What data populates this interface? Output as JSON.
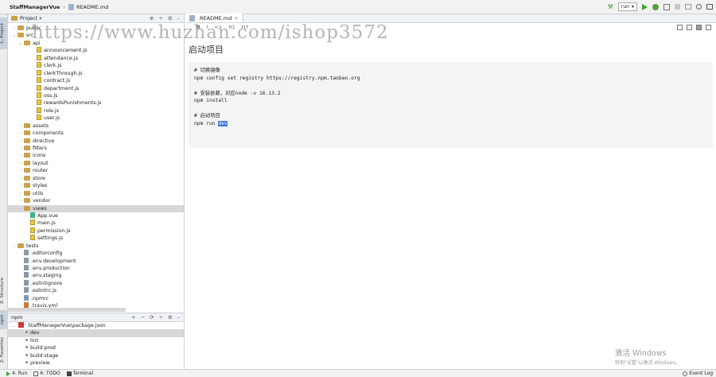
{
  "navbar": {
    "project": "StaffManagerVue",
    "file": "README.md",
    "run_config": "run"
  },
  "stripe": {
    "project_tab": "1: Project",
    "structure_tab": "Z: Structure",
    "npm_tab": "npm",
    "favorites_tab": "2: Favorites"
  },
  "project_panel": {
    "title": "Project",
    "tree": [
      {
        "label": "public",
        "indent": 1,
        "type": "folder",
        "arrow": "›"
      },
      {
        "label": "src",
        "indent": 1,
        "type": "folder",
        "arrow": "⌄"
      },
      {
        "label": "api",
        "indent": 2,
        "type": "folder",
        "arrow": "⌄"
      },
      {
        "label": "announcement.js",
        "indent": 4,
        "type": "js"
      },
      {
        "label": "attendance.js",
        "indent": 4,
        "type": "js"
      },
      {
        "label": "clerk.js",
        "indent": 4,
        "type": "js"
      },
      {
        "label": "clerkThrough.js",
        "indent": 4,
        "type": "js"
      },
      {
        "label": "contract.js",
        "indent": 4,
        "type": "js"
      },
      {
        "label": "department.js",
        "indent": 4,
        "type": "js"
      },
      {
        "label": "oss.js",
        "indent": 4,
        "type": "js"
      },
      {
        "label": "rewardsPunishments.js",
        "indent": 4,
        "type": "js"
      },
      {
        "label": "role.js",
        "indent": 4,
        "type": "js"
      },
      {
        "label": "user.js",
        "indent": 4,
        "type": "js"
      },
      {
        "label": "assets",
        "indent": 2,
        "type": "folder",
        "arrow": "›"
      },
      {
        "label": "components",
        "indent": 2,
        "type": "folder",
        "arrow": "›"
      },
      {
        "label": "directive",
        "indent": 2,
        "type": "folder",
        "arrow": "›"
      },
      {
        "label": "filters",
        "indent": 2,
        "type": "folder",
        "arrow": "›"
      },
      {
        "label": "icons",
        "indent": 2,
        "type": "folder",
        "arrow": "›"
      },
      {
        "label": "layout",
        "indent": 2,
        "type": "folder",
        "arrow": "›"
      },
      {
        "label": "router",
        "indent": 2,
        "type": "folder",
        "arrow": "›"
      },
      {
        "label": "store",
        "indent": 2,
        "type": "folder",
        "arrow": "›"
      },
      {
        "label": "styles",
        "indent": 2,
        "type": "folder",
        "arrow": "›"
      },
      {
        "label": "utils",
        "indent": 2,
        "type": "folder",
        "arrow": "›"
      },
      {
        "label": "vendor",
        "indent": 2,
        "type": "folder",
        "arrow": "›"
      },
      {
        "label": "views",
        "indent": 2,
        "type": "folder",
        "arrow": "›",
        "selected": true
      },
      {
        "label": "App.vue",
        "indent": 3,
        "type": "vue"
      },
      {
        "label": "main.js",
        "indent": 3,
        "type": "js"
      },
      {
        "label": "permission.js",
        "indent": 3,
        "type": "js"
      },
      {
        "label": "settings.js",
        "indent": 3,
        "type": "js"
      },
      {
        "label": "tests",
        "indent": 1,
        "type": "folder",
        "arrow": "›"
      },
      {
        "label": ".editorconfig",
        "indent": 2,
        "type": "cfg"
      },
      {
        "label": ".env.development",
        "indent": 2,
        "type": "cfg"
      },
      {
        "label": ".env.production",
        "indent": 2,
        "type": "cfg"
      },
      {
        "label": ".env.staging",
        "indent": 2,
        "type": "cfg"
      },
      {
        "label": ".eslintignore",
        "indent": 2,
        "type": "cfg"
      },
      {
        "label": ".eslintrc.js",
        "indent": 2,
        "type": "cfg"
      },
      {
        "label": ".npmrc",
        "indent": 2,
        "type": "cfg"
      },
      {
        "label": ".travis.yml",
        "indent": 2,
        "type": "yml"
      }
    ]
  },
  "npm_panel": {
    "title": "npm",
    "package": "StaffManagerVue\\package.json",
    "scripts": [
      {
        "label": "dev",
        "selected": true
      },
      {
        "label": "lint"
      },
      {
        "label": "build:prod"
      },
      {
        "label": "build:stage"
      },
      {
        "label": "preview"
      }
    ]
  },
  "editor": {
    "tab": "README.md",
    "md_tools": [
      "B",
      "I",
      "<>",
      "H1",
      "H↑"
    ],
    "preview_title": "启动项目",
    "code": [
      "# 切换镜像",
      "npm config set registry https://registry.npm.taobao.org",
      "",
      "# 安装依赖，对应node -v 16.13.2",
      "npm install",
      "",
      "# 启动项目"
    ],
    "last_line_prefix": "npm run ",
    "last_line_selected": "dev"
  },
  "watermark": "https://www.huzhan.com/ishop3572",
  "windows_mark": {
    "title": "激活 Windows",
    "subtitle": "转到\"设置\"以激活 Windows。"
  },
  "bottom_bar": {
    "run": "4: Run",
    "todo": "6: TODO",
    "terminal": "Terminal",
    "event_log": "Event Log"
  }
}
